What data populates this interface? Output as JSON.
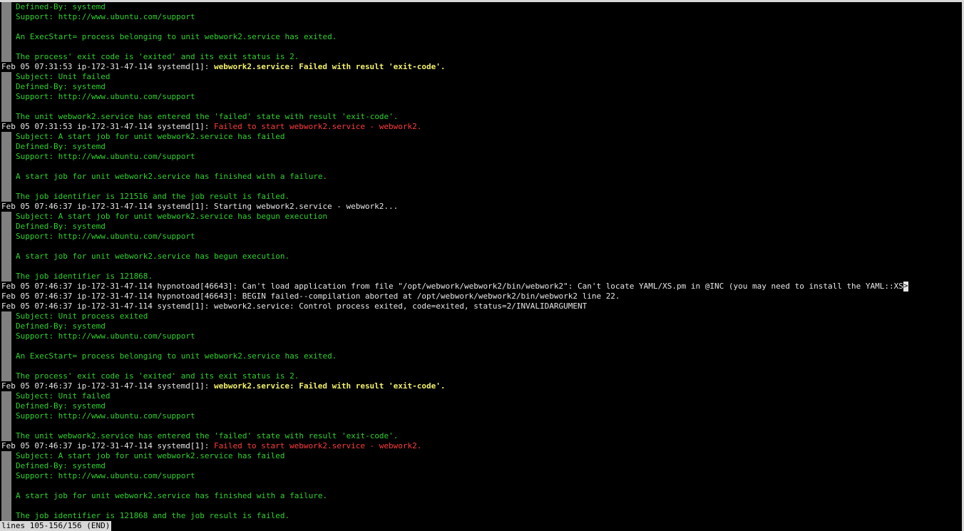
{
  "window": {
    "colors": {
      "background": "#000000",
      "default_text": "#e6e6e6",
      "green_text": "#2fd12f",
      "yellow_text": "#f2f06a",
      "red_text": "#ff3b3b",
      "margin_bar": "#808080",
      "status_bar_bg": "#d8d8d8"
    }
  },
  "lines": [
    {
      "type": "g",
      "text": "Defined-By: systemd"
    },
    {
      "type": "g",
      "text": "Support: http://www.ubuntu.com/support"
    },
    {
      "type": "g",
      "text": ""
    },
    {
      "type": "g",
      "text": "An ExecStart= process belonging to unit webwork2.service has exited."
    },
    {
      "type": "g",
      "text": ""
    },
    {
      "type": "g",
      "text": "The process' exit code is 'exited' and its exit status is 2."
    },
    {
      "type": "y",
      "prefix": "Feb 05 07:31:53 ip-172-31-47-114 systemd[1]: ",
      "text": "webwork2.service: Failed with result 'exit-code'."
    },
    {
      "type": "g",
      "text": "Subject: Unit failed"
    },
    {
      "type": "g",
      "text": "Defined-By: systemd"
    },
    {
      "type": "g",
      "text": "Support: http://www.ubuntu.com/support"
    },
    {
      "type": "g",
      "text": ""
    },
    {
      "type": "g",
      "text": "The unit webwork2.service has entered the 'failed' state with result 'exit-code'."
    },
    {
      "type": "r",
      "prefix": "Feb 05 07:31:53 ip-172-31-47-114 systemd[1]: ",
      "text": "Failed to start webwork2.service - webwork2."
    },
    {
      "type": "g",
      "text": "Subject: A start job for unit webwork2.service has failed"
    },
    {
      "type": "g",
      "text": "Defined-By: systemd"
    },
    {
      "type": "g",
      "text": "Support: http://www.ubuntu.com/support"
    },
    {
      "type": "g",
      "text": ""
    },
    {
      "type": "g",
      "text": "A start job for unit webwork2.service has finished with a failure."
    },
    {
      "type": "g",
      "text": ""
    },
    {
      "type": "g",
      "text": "The job identifier is 121516 and the job result is failed."
    },
    {
      "type": "w",
      "text": "Feb 05 07:46:37 ip-172-31-47-114 systemd[1]: Starting webwork2.service - webwork2..."
    },
    {
      "type": "g",
      "text": "Subject: A start job for unit webwork2.service has begun execution"
    },
    {
      "type": "g",
      "text": "Defined-By: systemd"
    },
    {
      "type": "g",
      "text": "Support: http://www.ubuntu.com/support"
    },
    {
      "type": "g",
      "text": ""
    },
    {
      "type": "g",
      "text": "A start job for unit webwork2.service has begun execution."
    },
    {
      "type": "g",
      "text": ""
    },
    {
      "type": "g",
      "text": "The job identifier is 121868."
    },
    {
      "type": "wc",
      "text": "Feb 05 07:46:37 ip-172-31-47-114 hypnotoad[46643]: Can't load application from file \"/opt/webwork/webwork2/bin/webwork2\": Can't locate YAML/XS.pm in @INC (you may need to install the YAML::XS",
      "cursor": ">"
    },
    {
      "type": "w",
      "text": "Feb 05 07:46:37 ip-172-31-47-114 hypnotoad[46643]: BEGIN failed--compilation aborted at /opt/webwork/webwork2/bin/webwork2 line 22."
    },
    {
      "type": "w",
      "text": "Feb 05 07:46:37 ip-172-31-47-114 systemd[1]: webwork2.service: Control process exited, code=exited, status=2/INVALIDARGUMENT"
    },
    {
      "type": "g",
      "text": "Subject: Unit process exited"
    },
    {
      "type": "g",
      "text": "Defined-By: systemd"
    },
    {
      "type": "g",
      "text": "Support: http://www.ubuntu.com/support"
    },
    {
      "type": "g",
      "text": ""
    },
    {
      "type": "g",
      "text": "An ExecStart= process belonging to unit webwork2.service has exited."
    },
    {
      "type": "g",
      "text": ""
    },
    {
      "type": "g",
      "text": "The process' exit code is 'exited' and its exit status is 2."
    },
    {
      "type": "y",
      "prefix": "Feb 05 07:46:37 ip-172-31-47-114 systemd[1]: ",
      "text": "webwork2.service: Failed with result 'exit-code'."
    },
    {
      "type": "g",
      "text": "Subject: Unit failed"
    },
    {
      "type": "g",
      "text": "Defined-By: systemd"
    },
    {
      "type": "g",
      "text": "Support: http://www.ubuntu.com/support"
    },
    {
      "type": "g",
      "text": ""
    },
    {
      "type": "g",
      "text": "The unit webwork2.service has entered the 'failed' state with result 'exit-code'."
    },
    {
      "type": "r",
      "prefix": "Feb 05 07:46:37 ip-172-31-47-114 systemd[1]: ",
      "text": "Failed to start webwork2.service - webwork2."
    },
    {
      "type": "g",
      "text": "Subject: A start job for unit webwork2.service has failed"
    },
    {
      "type": "g",
      "text": "Defined-By: systemd"
    },
    {
      "type": "g",
      "text": "Support: http://www.ubuntu.com/support"
    },
    {
      "type": "g",
      "text": ""
    },
    {
      "type": "g",
      "text": "A start job for unit webwork2.service has finished with a failure."
    },
    {
      "type": "g",
      "text": ""
    },
    {
      "type": "g",
      "text": "The job identifier is 121868 and the job result is failed."
    }
  ],
  "status_bar": {
    "text": "lines 105-156/156 (END)"
  }
}
